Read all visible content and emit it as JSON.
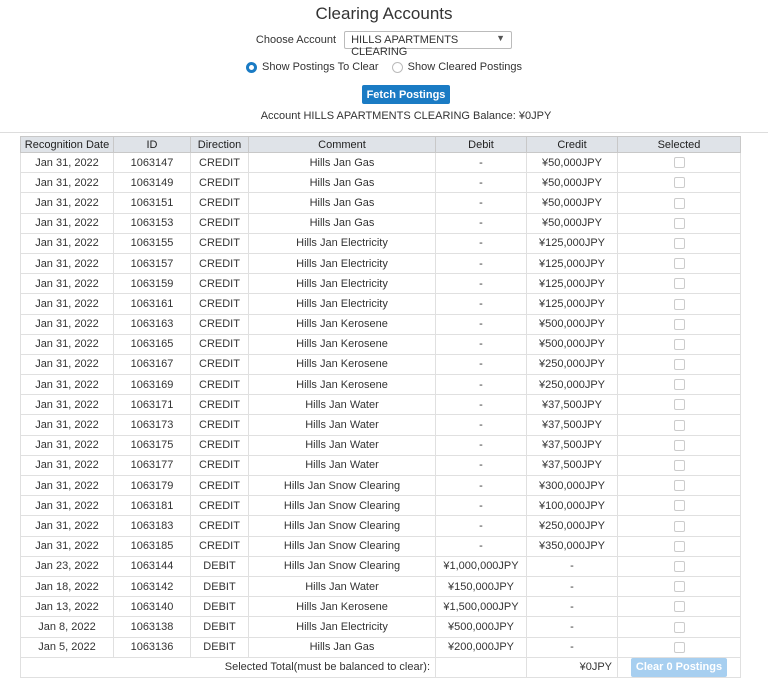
{
  "title": "Clearing Accounts",
  "choose": {
    "label": "Choose Account",
    "selected": "HILLS APARTMENTS CLEARING"
  },
  "radios": [
    {
      "label": "Show Postings To Clear",
      "checked": true
    },
    {
      "label": "Show Cleared Postings",
      "checked": false
    }
  ],
  "fetch_label": "Fetch Postings",
  "balance_text": "Account HILLS APARTMENTS CLEARING Balance: ¥0JPY",
  "columns": [
    "Recognition Date",
    "ID",
    "Direction",
    "Comment",
    "Debit",
    "Credit",
    "Selected"
  ],
  "rows": [
    [
      "Jan 31, 2022",
      "1063147",
      "CREDIT",
      "Hills Jan Gas",
      "-",
      "¥50,000JPY"
    ],
    [
      "Jan 31, 2022",
      "1063149",
      "CREDIT",
      "Hills Jan Gas",
      "-",
      "¥50,000JPY"
    ],
    [
      "Jan 31, 2022",
      "1063151",
      "CREDIT",
      "Hills Jan Gas",
      "-",
      "¥50,000JPY"
    ],
    [
      "Jan 31, 2022",
      "1063153",
      "CREDIT",
      "Hills Jan Gas",
      "-",
      "¥50,000JPY"
    ],
    [
      "Jan 31, 2022",
      "1063155",
      "CREDIT",
      "Hills Jan Electricity",
      "-",
      "¥125,000JPY"
    ],
    [
      "Jan 31, 2022",
      "1063157",
      "CREDIT",
      "Hills Jan Electricity",
      "-",
      "¥125,000JPY"
    ],
    [
      "Jan 31, 2022",
      "1063159",
      "CREDIT",
      "Hills Jan Electricity",
      "-",
      "¥125,000JPY"
    ],
    [
      "Jan 31, 2022",
      "1063161",
      "CREDIT",
      "Hills Jan Electricity",
      "-",
      "¥125,000JPY"
    ],
    [
      "Jan 31, 2022",
      "1063163",
      "CREDIT",
      "Hills Jan Kerosene",
      "-",
      "¥500,000JPY"
    ],
    [
      "Jan 31, 2022",
      "1063165",
      "CREDIT",
      "Hills Jan Kerosene",
      "-",
      "¥500,000JPY"
    ],
    [
      "Jan 31, 2022",
      "1063167",
      "CREDIT",
      "Hills Jan Kerosene",
      "-",
      "¥250,000JPY"
    ],
    [
      "Jan 31, 2022",
      "1063169",
      "CREDIT",
      "Hills Jan Kerosene",
      "-",
      "¥250,000JPY"
    ],
    [
      "Jan 31, 2022",
      "1063171",
      "CREDIT",
      "Hills Jan Water",
      "-",
      "¥37,500JPY"
    ],
    [
      "Jan 31, 2022",
      "1063173",
      "CREDIT",
      "Hills Jan Water",
      "-",
      "¥37,500JPY"
    ],
    [
      "Jan 31, 2022",
      "1063175",
      "CREDIT",
      "Hills Jan Water",
      "-",
      "¥37,500JPY"
    ],
    [
      "Jan 31, 2022",
      "1063177",
      "CREDIT",
      "Hills Jan Water",
      "-",
      "¥37,500JPY"
    ],
    [
      "Jan 31, 2022",
      "1063179",
      "CREDIT",
      "Hills Jan Snow Clearing",
      "-",
      "¥300,000JPY"
    ],
    [
      "Jan 31, 2022",
      "1063181",
      "CREDIT",
      "Hills Jan Snow Clearing",
      "-",
      "¥100,000JPY"
    ],
    [
      "Jan 31, 2022",
      "1063183",
      "CREDIT",
      "Hills Jan Snow Clearing",
      "-",
      "¥250,000JPY"
    ],
    [
      "Jan 31, 2022",
      "1063185",
      "CREDIT",
      "Hills Jan Snow Clearing",
      "-",
      "¥350,000JPY"
    ],
    [
      "Jan 23, 2022",
      "1063144",
      "DEBIT",
      "Hills Jan Snow Clearing",
      "¥1,000,000JPY",
      "-"
    ],
    [
      "Jan 18, 2022",
      "1063142",
      "DEBIT",
      "Hills Jan Water",
      "¥150,000JPY",
      "-"
    ],
    [
      "Jan 13, 2022",
      "1063140",
      "DEBIT",
      "Hills Jan Kerosene",
      "¥1,500,000JPY",
      "-"
    ],
    [
      "Jan 8, 2022",
      "1063138",
      "DEBIT",
      "Hills Jan Electricity",
      "¥500,000JPY",
      "-"
    ],
    [
      "Jan 5, 2022",
      "1063136",
      "DEBIT",
      "Hills Jan Gas",
      "¥200,000JPY",
      "-"
    ]
  ],
  "footer": {
    "label": "Selected Total(must be balanced to clear):",
    "total": "¥0JPY",
    "button": "Clear 0 Postings"
  }
}
